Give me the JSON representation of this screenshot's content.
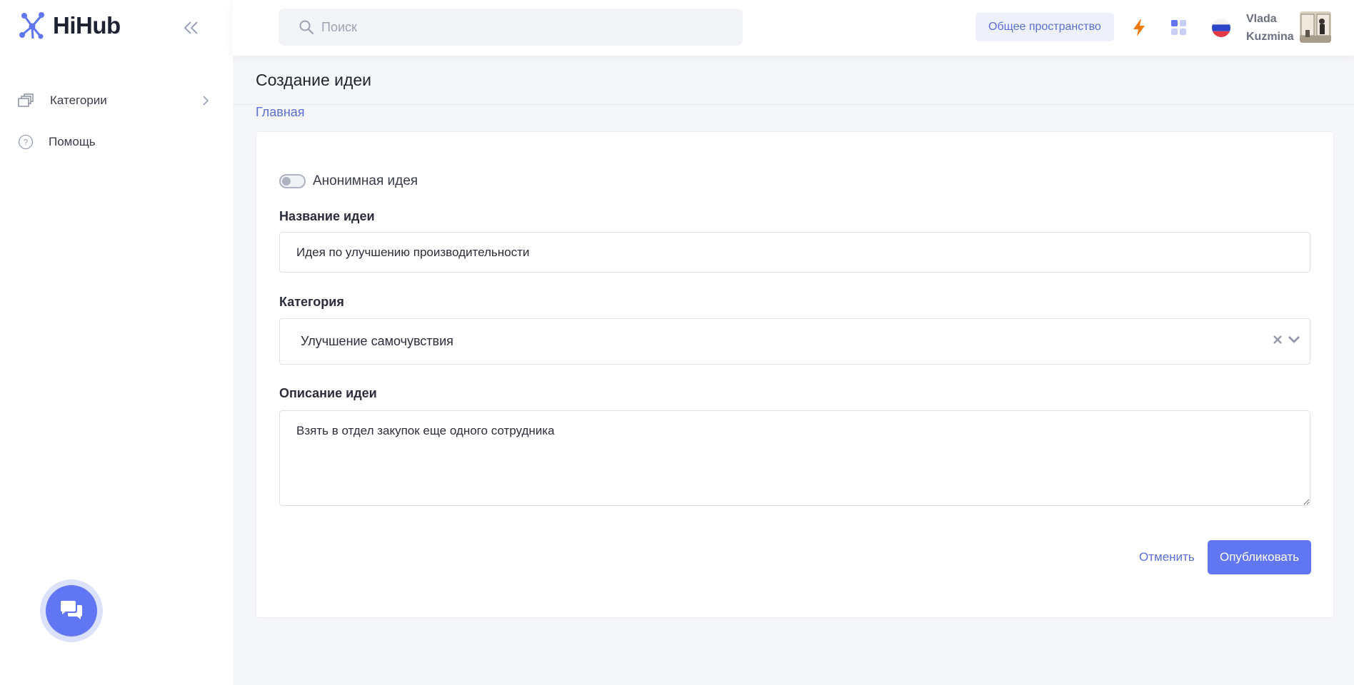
{
  "app": {
    "name": "HiHub"
  },
  "sidebar": {
    "items": [
      {
        "label": "Категории",
        "icon": "layers-icon"
      },
      {
        "label": "Помощь",
        "icon": "help-circle-icon"
      }
    ]
  },
  "header": {
    "search_placeholder": "Поиск",
    "workspace_label": "Общее пространство",
    "user": {
      "first_name": "Vlada",
      "last_name": "Kuzmina"
    },
    "language": "ru"
  },
  "page": {
    "title": "Создание идеи",
    "breadcrumb": "Главная"
  },
  "form": {
    "anonymous_label": "Анонимная идея",
    "anonymous_enabled": false,
    "name_label": "Название идеи",
    "name_value": "Идея по улучшению производительности",
    "category_label": "Категория",
    "category_value": "Улучшение самочувствия",
    "description_label": "Описание идеи",
    "description_value": "Взять в отдел закупок еще одного сотрудника",
    "cancel_label": "Отменить",
    "publish_label": "Опубликовать"
  },
  "colors": {
    "accent": "#6176f2",
    "link": "#5b6fd6",
    "lightning": "#f07a12"
  }
}
